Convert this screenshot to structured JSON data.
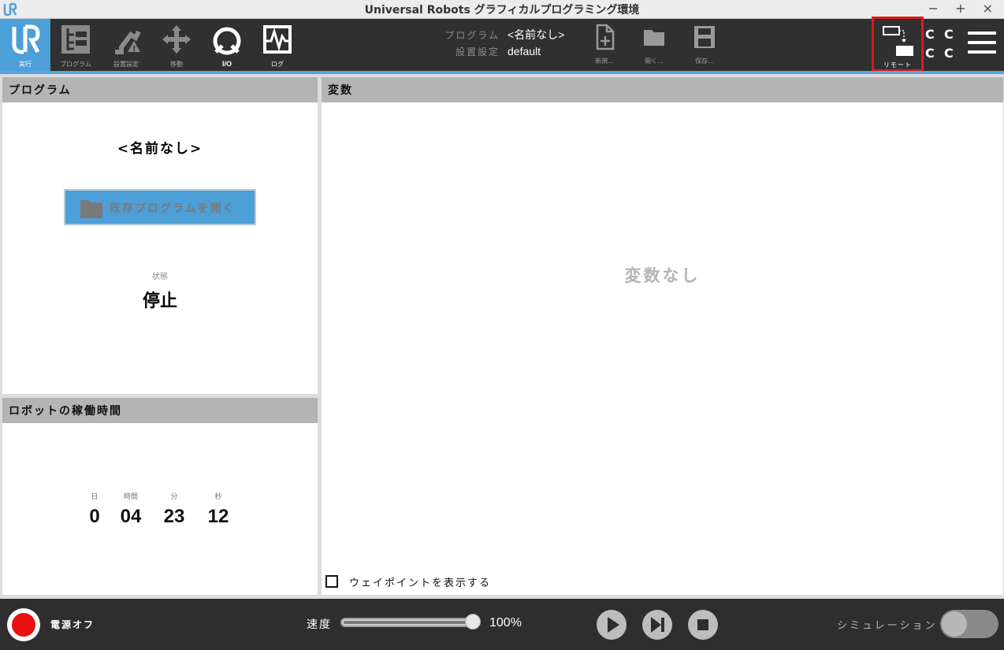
{
  "window": {
    "title": "Universal Robots グラフィカルプログラミング環境",
    "controls": [
      "−",
      "+",
      "×"
    ]
  },
  "nav": {
    "items": [
      {
        "label": "実行",
        "icon": "ur-logo-icon",
        "active": true
      },
      {
        "label": "プログラム",
        "icon": "program-tree-icon"
      },
      {
        "label": "設置設定",
        "icon": "robot-arm-icon"
      },
      {
        "label": "移動",
        "icon": "move-arrows-icon"
      },
      {
        "label": "I/O",
        "icon": "io-icon"
      },
      {
        "label": "ログ",
        "icon": "log-graph-icon"
      }
    ]
  },
  "program_info": {
    "program_key": "プログラム",
    "program_value": "<名前なし>",
    "install_key": "設置設定",
    "install_value": "default"
  },
  "file_actions": {
    "new_label": "新規...",
    "open_label": "開く...",
    "save_label": "保存..."
  },
  "remote": {
    "label": "リモート"
  },
  "cc": [
    "C",
    "C",
    "C",
    "C"
  ],
  "program_panel": {
    "header": "プログラム",
    "name": "<名前なし>",
    "open_button": "既存プログラムを開く",
    "state_label": "状態",
    "state_value": "停止"
  },
  "uptime_panel": {
    "header": "ロボットの稼働時間",
    "units": [
      "日",
      "時間",
      "分",
      "秒"
    ],
    "values": [
      "0",
      "04",
      "23",
      "12"
    ]
  },
  "vars_panel": {
    "header": "変数",
    "empty_text": "変数なし",
    "waypoint_label": "ウェイポイントを表示する",
    "waypoint_checked": false
  },
  "bottom": {
    "power_label": "電源オフ",
    "speed_label": "速度",
    "speed_value": "100%",
    "speed_fraction": 1.0,
    "sim_label": "シミュレーション",
    "sim_on": false
  },
  "colors": {
    "accent": "#4d9fd8",
    "toolbar": "#303030",
    "power": "#e81010",
    "highlight": "#e01818"
  }
}
